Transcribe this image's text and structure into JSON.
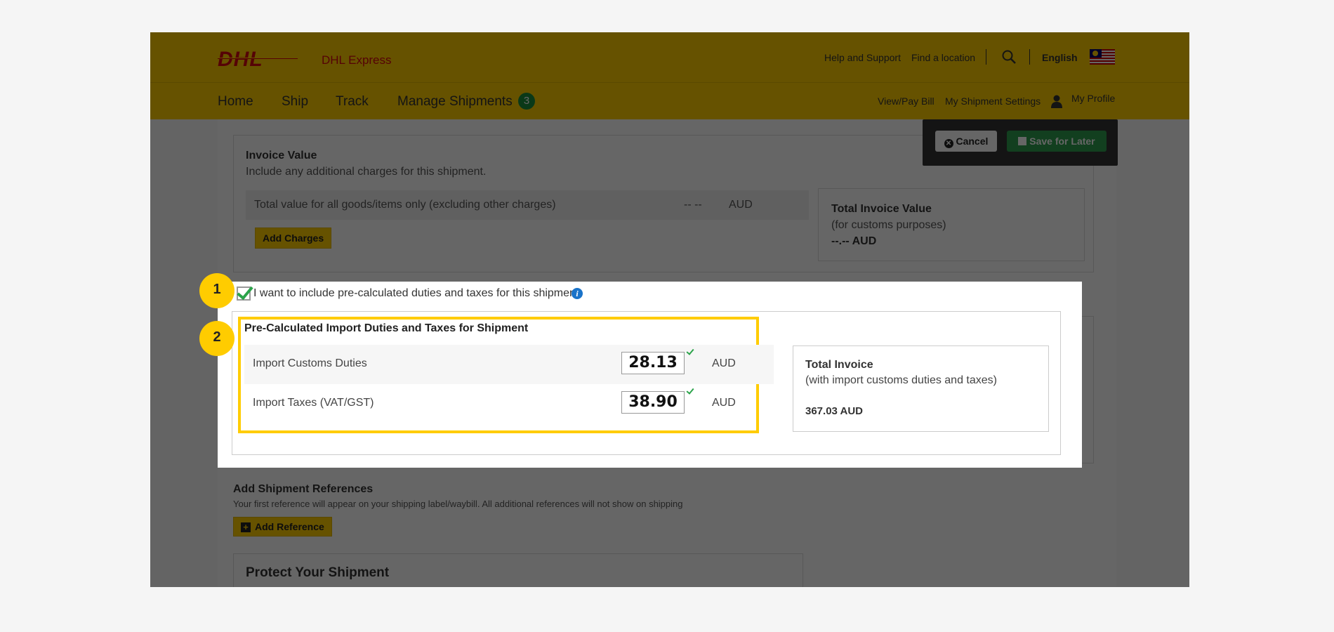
{
  "header": {
    "logo_text": "DHL",
    "brand": "DHL Express",
    "help": "Help and Support",
    "find_location": "Find a location",
    "divider": "|",
    "language": "English",
    "nav": [
      "Home",
      "Ship",
      "Track",
      "Manage Shipments"
    ],
    "manage_badge": "3",
    "subnav": [
      "View/Pay Bill",
      "My Shipment Settings",
      "My Profile"
    ]
  },
  "actions": {
    "cancel": "Cancel",
    "save_later": "Save for Later"
  },
  "invoice": {
    "title": "Invoice Value",
    "subtitle": "Include any additional charges for this shipment.",
    "row_label": "Total value for all goods/items only (excluding other charges)",
    "row_value": "-- --",
    "row_currency": "AUD",
    "add_charges": "Add Charges",
    "total_title": "Total Invoice Value",
    "total_sub": "(for customs purposes)",
    "total_value": "--.-- AUD"
  },
  "duties": {
    "checkbox_label": "I want to include pre-calculated duties and taxes for this shipment",
    "checked": true,
    "section_title": "Pre-Calculated Import Duties and Taxes for Shipment",
    "rows": [
      {
        "label": "Import Customs Duties",
        "value": "28.13",
        "currency": "AUD"
      },
      {
        "label": "Import Taxes (VAT/GST)",
        "value": "38.90",
        "currency": "AUD"
      }
    ],
    "total_title": "Total Invoice",
    "total_sub": "(with import customs duties and taxes)",
    "total_value": "367.03 AUD"
  },
  "references": {
    "title": "Add Shipment References",
    "subtitle": "Your first reference will appear on your shipping label/waybill. All additional references will not show on shipping",
    "button": "Add Reference"
  },
  "protect": {
    "title": "Protect Your Shipment"
  },
  "callouts": [
    "1",
    "2"
  ],
  "colors": {
    "dhl_yellow": "#ffcc00",
    "dhl_red": "#d40511",
    "success_green": "#2ba34a",
    "info_blue": "#1a73c9"
  }
}
